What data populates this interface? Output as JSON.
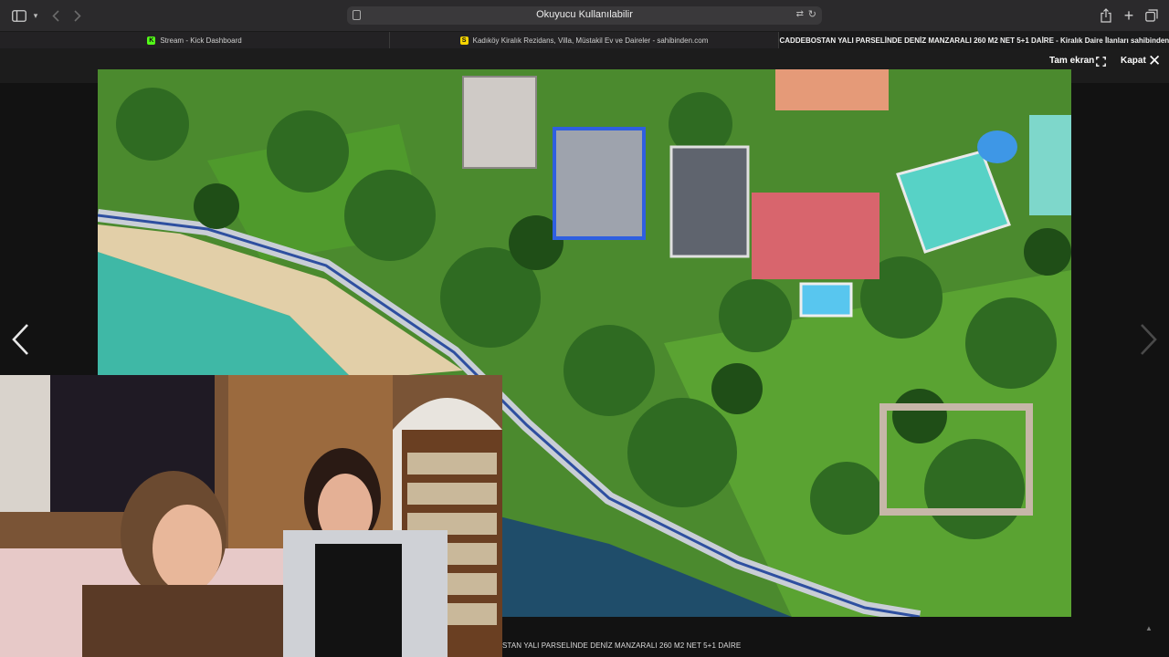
{
  "browser": {
    "address_text": "Okuyucu Kullanılabilir",
    "tabs": [
      {
        "label": "Stream - Kick Dashboard",
        "favicon": "K",
        "favicon_color": "#53fc18"
      },
      {
        "label": "Kadıköy Kiralık Rezidans, Villa, Müstakil Ev ve Daireler - sahibinden.com",
        "favicon": "S",
        "favicon_color": "#f7d501"
      },
      {
        "label": "CADDEBOSTAN YALI PARSELİNDE DENİZ MANZARALI 260 M2 NET 5+1 DAİRE - Kiralık Daire İlanları sahibinden.c...",
        "favicon": "S",
        "favicon_color": "#f7d501",
        "active": true
      }
    ]
  },
  "lightbox": {
    "fullscreen_label": "Tam ekran",
    "close_label": "Kapat",
    "caption": "STAN YALI PARSELİNDE DENİZ MANZARALI 260 M2 NET 5+1 DAİRE"
  },
  "icons": {
    "sidebar": "sidebar-icon",
    "back": "chevron-left-icon",
    "forward": "chevron-right-icon",
    "reader": "reader-icon",
    "translate": "translate-icon",
    "reload": "reload-icon",
    "share": "share-icon",
    "new_tab": "plus-icon",
    "tab_overview": "tab-overview-icon",
    "fullscreen": "fullscreen-icon",
    "close": "close-icon",
    "prev": "chevron-left-icon",
    "next": "chevron-right-icon"
  },
  "colors": {
    "toolbar": "#2b2a2c",
    "kick": "#53fc18",
    "sahibinden": "#f7d501"
  }
}
